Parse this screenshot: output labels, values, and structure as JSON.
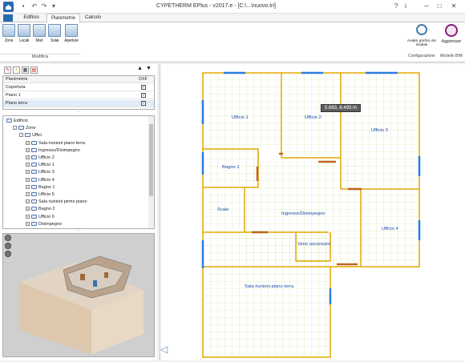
{
  "titlebar": {
    "title": "CYPETHERM EPlus - v2017.e - [C:\\...\\nuovo.tri]",
    "quick_access": [
      "save-icon",
      "undo-icon",
      "redo-icon",
      "dropdown-icon"
    ],
    "window_buttons": [
      "minimize-icon",
      "maximize-icon",
      "close-icon"
    ]
  },
  "tabs": [
    {
      "label": "Edificio",
      "active": false
    },
    {
      "label": "Planimetrie",
      "active": true
    },
    {
      "label": "Calcolo",
      "active": false
    }
  ],
  "ribbon": {
    "modifica_buttons": [
      "Zone",
      "Locali",
      "Muri",
      "Solai",
      "Aperture"
    ],
    "modifica_label": "Modifica",
    "config_button": "Analisi grafica dei risultati",
    "config_label": "Configurazione",
    "bim_button": "Aggiornare",
    "bim_label": "Modello BIM"
  },
  "planimetrie": {
    "header_name": "Planimetrie",
    "header_dxf": "DXF",
    "rows": [
      {
        "name": "Copertura",
        "checked": true
      },
      {
        "name": "Piano 1",
        "checked": true
      },
      {
        "name": "Piano terra",
        "checked": true,
        "selected": true
      }
    ]
  },
  "tree": [
    {
      "label": "Edificio",
      "level": 0,
      "expand": ""
    },
    {
      "label": "Zone",
      "level": 1,
      "expand": "-"
    },
    {
      "label": "Uffici",
      "level": 2,
      "expand": "-"
    },
    {
      "label": "Sala riunioni piano terra",
      "level": 3,
      "expand": "+"
    },
    {
      "label": "Ingresso/Disimpegno",
      "level": 3,
      "expand": "+"
    },
    {
      "label": "Ufficio 2",
      "level": 3,
      "expand": "+"
    },
    {
      "label": "Ufficio 1",
      "level": 3,
      "expand": "+"
    },
    {
      "label": "Ufficio 3",
      "level": 3,
      "expand": "+"
    },
    {
      "label": "Ufficio 4",
      "level": 3,
      "expand": "+"
    },
    {
      "label": "Bagno 1",
      "level": 3,
      "expand": "+"
    },
    {
      "label": "Ufficio 5",
      "level": 3,
      "expand": "+"
    },
    {
      "label": "Sala riunioni pirmo piano",
      "level": 3,
      "expand": "+"
    },
    {
      "label": "Bagno 2",
      "level": 3,
      "expand": "+"
    },
    {
      "label": "Ufficio 6",
      "level": 3,
      "expand": "+"
    },
    {
      "label": "Disimpegno",
      "level": 3,
      "expand": "+"
    }
  ],
  "plan": {
    "rooms": [
      "Ufficio 1",
      "Ufficio 2",
      "Ufficio 3",
      "Bagno 1",
      "Scale",
      "Ingresso/Disimpegno",
      "Ufficio 4",
      "Vano ascensore",
      "Sala riunioni piano terra"
    ],
    "tooltip": "5.683, 8.493 m"
  },
  "colors": {
    "wall": "#e0a800",
    "grid": "#cfe0a0",
    "window": "#2a7de1",
    "door": "#c0651f",
    "room_label": "#1a4ba8",
    "accent": "#2a6bb0"
  }
}
